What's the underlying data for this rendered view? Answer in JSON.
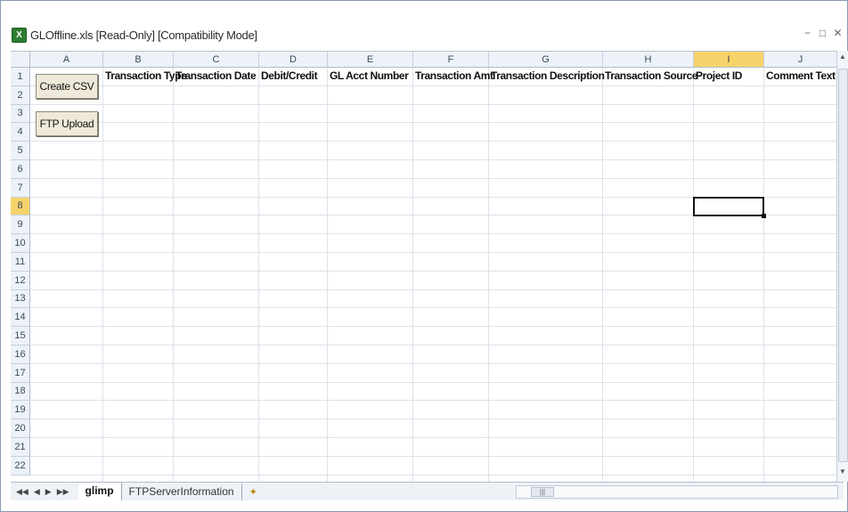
{
  "window": {
    "title": "GLOffline.xls  [Read-Only]  [Compatibility Mode]",
    "icon": "excel-icon",
    "controls": [
      "minimize-icon",
      "restore-icon",
      "close-icon"
    ]
  },
  "columns": [
    "A",
    "B",
    "C",
    "D",
    "E",
    "F",
    "G",
    "H",
    "I",
    "J"
  ],
  "selected_column": "I",
  "rows": [
    "1",
    "2",
    "3",
    "4",
    "5",
    "6",
    "7",
    "8",
    "9",
    "10",
    "11",
    "12",
    "13",
    "14",
    "15",
    "16",
    "17",
    "18",
    "19",
    "20",
    "21",
    "22"
  ],
  "selected_row": "8",
  "headers": {
    "B": "Transaction Type",
    "C": "Transaction Date",
    "D": "Debit/Credit",
    "E": "GL Acct Number",
    "F": "Transaction Amt",
    "G": "Transaction Description",
    "H": "Transaction Source",
    "I": "Project ID",
    "J": "Comment Text"
  },
  "buttons": {
    "create_csv": "Create CSV",
    "ftp_upload": "FTP Upload"
  },
  "tabs": [
    {
      "label": "glimp",
      "active": true
    },
    {
      "label": "FTPServerInformation",
      "active": false
    }
  ],
  "colors": {
    "selection_header": "#f6d36a",
    "header_bg": "#edf2f8"
  }
}
